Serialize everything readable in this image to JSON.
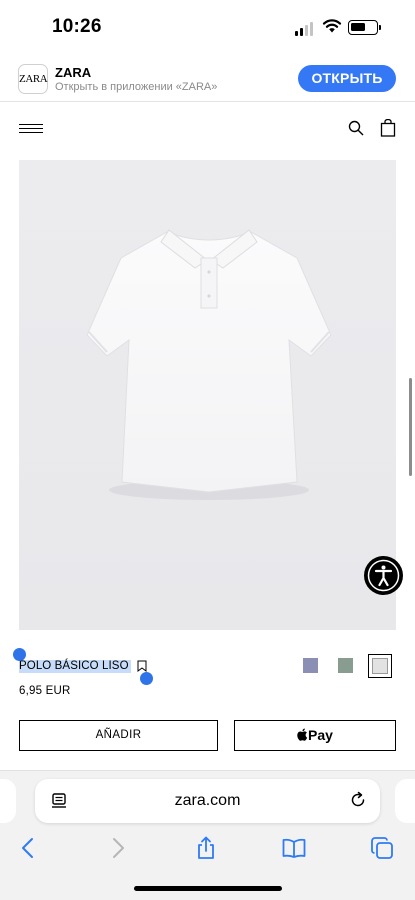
{
  "status_bar": {
    "time": "10:26",
    "battery_level": 0.6
  },
  "app_banner": {
    "logo_text": "ZARA",
    "name": "ZARA",
    "subtitle": "Открыть в приложении «ZARA»",
    "open_button": "ОТКРЫТЬ"
  },
  "header": {
    "icons": [
      "menu-icon",
      "search-icon",
      "bag-icon"
    ]
  },
  "product": {
    "name": "POLO BÁSICO LISO",
    "price": "6,95 EUR",
    "swatches": [
      {
        "color": "#8c8fb4",
        "selected": false
      },
      {
        "color": "#889c8f",
        "selected": false
      },
      {
        "color": "#e2e2e2",
        "selected": true
      }
    ],
    "add_button": "AÑADIR",
    "pay_button": "Pay"
  },
  "browser": {
    "url": "zara.com"
  },
  "colors": {
    "accent": "#3478f6",
    "selection": "#c6dcf8",
    "selection_handle": "#2f73e8",
    "ios_blue": "#2f7bf5"
  }
}
